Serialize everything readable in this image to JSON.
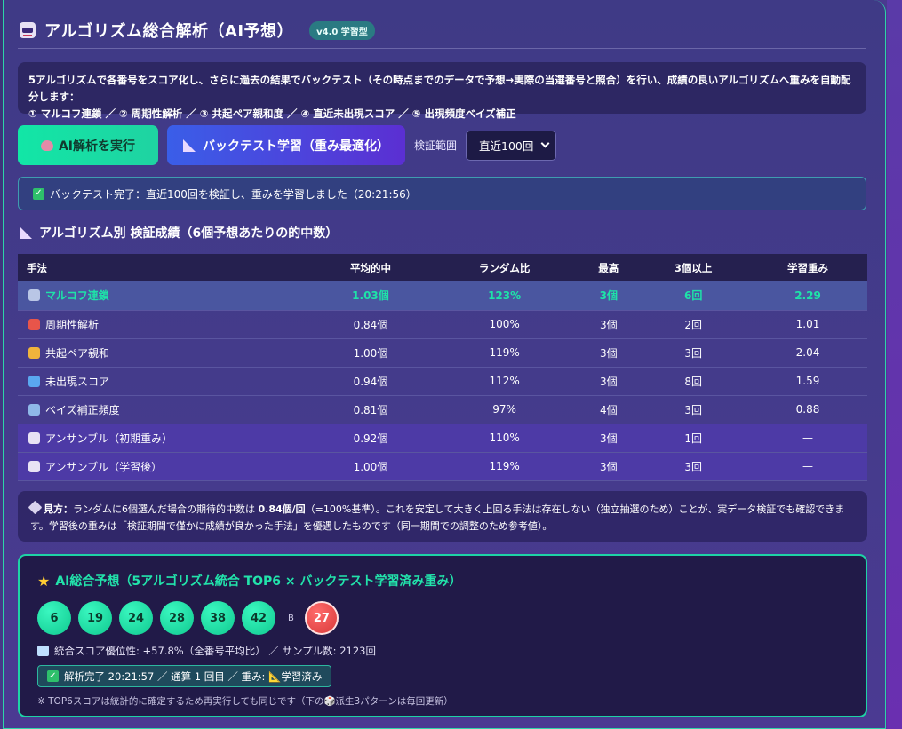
{
  "header": {
    "title": "アルゴリズム総合解析（AI予想）",
    "version": "v4.0 学習型"
  },
  "intro": {
    "line1": "5アルゴリズムで各番号をスコア化し、さらに過去の結果でバックテスト（その時点までのデータで予想→実際の当選番号と照合）を行い、成績の良いアルゴリズムへ重みを自動配分します：",
    "line2": "① マルコフ連鎖 ／ ② 周期性解析 ／ ③ 共起ペア親和度 ／ ④ 直近未出現スコア ／ ⑤ 出現頻度ベイズ補正"
  },
  "controls": {
    "ai_button": "AI解析を実行",
    "backtest_button": "バックテスト学習（重み最適化）",
    "range_label": "検証範囲",
    "range_value": "直近100回"
  },
  "status": {
    "text": "バックテスト完了：直近100回を検証し、重みを学習しました（20:21:56）"
  },
  "section": {
    "title": "アルゴリズム別 検証成績（6個予想あたりの的中数）"
  },
  "table": {
    "headers": [
      "手法",
      "平均的中",
      "ランダム比",
      "最高",
      "3個以上",
      "学習重み"
    ],
    "rows": [
      {
        "name": "マルコフ連鎖",
        "avg": "1.03個",
        "ratio": "123%",
        "max": "3個",
        "over3": "6回",
        "weight": "2.29",
        "icon": "link-icon",
        "color": "#b9c6e6"
      },
      {
        "name": "周期性解析",
        "avg": "0.84個",
        "ratio": "100%",
        "max": "3個",
        "over3": "2回",
        "weight": "1.01",
        "icon": "alarm-clock-icon",
        "color": "#e8554a"
      },
      {
        "name": "共起ペア親和",
        "avg": "1.00個",
        "ratio": "119%",
        "max": "3個",
        "over3": "3回",
        "weight": "2.04",
        "icon": "handshake-icon",
        "color": "#f0b43c"
      },
      {
        "name": "未出現スコア",
        "avg": "0.94個",
        "ratio": "112%",
        "max": "3個",
        "over3": "8回",
        "weight": "1.59",
        "icon": "sleep-icon",
        "color": "#5aa8f0"
      },
      {
        "name": "ベイズ補正頻度",
        "avg": "0.81個",
        "ratio": "97%",
        "max": "4個",
        "over3": "3回",
        "weight": "0.88",
        "icon": "bar-chart-icon",
        "color": "#8fb8e8"
      },
      {
        "name": "アンサンブル（初期重み）",
        "avg": "0.92個",
        "ratio": "110%",
        "max": "3個",
        "over3": "1回",
        "weight": "—",
        "icon": "robot-icon",
        "color": "#e8e2f4"
      },
      {
        "name": "アンサンブル（学習後）",
        "avg": "1.00個",
        "ratio": "119%",
        "max": "3個",
        "over3": "3回",
        "weight": "—",
        "icon": "robot-icon",
        "color": "#e8e2f4"
      }
    ]
  },
  "tip": {
    "label": "見方：",
    "text1": "ランダムに6個選んだ場合の期待的中数は ",
    "bold": "0.84個/回",
    "text2": "（=100%基準）。これを安定して大きく上回る手法は存在しない（独立抽選のため）ことが、実データ検証でも確認できます。学習後の重みは「検証期間で僅かに成績が良かった手法」を優遇したものです（同一期間での調整のため参考値）。"
  },
  "prediction": {
    "title": "AI総合予想（5アルゴリズム統合 TOP6 × バックテスト学習済み重み）",
    "numbers": [
      "6",
      "19",
      "24",
      "28",
      "38",
      "42"
    ],
    "bonus_label": "B",
    "bonus": "27",
    "stat": "統合スコア優位性: +57.8%（全番号平均比） ／ サンプル数: 2123回",
    "done": "解析完了 20:21:57 ／ 通算 1 回目 ／ 重み: 📐学習済み",
    "note": "※ TOP6スコアは統計的に確定するため再実行しても同じです（下の🎲派生3パターンは毎回更新）"
  }
}
